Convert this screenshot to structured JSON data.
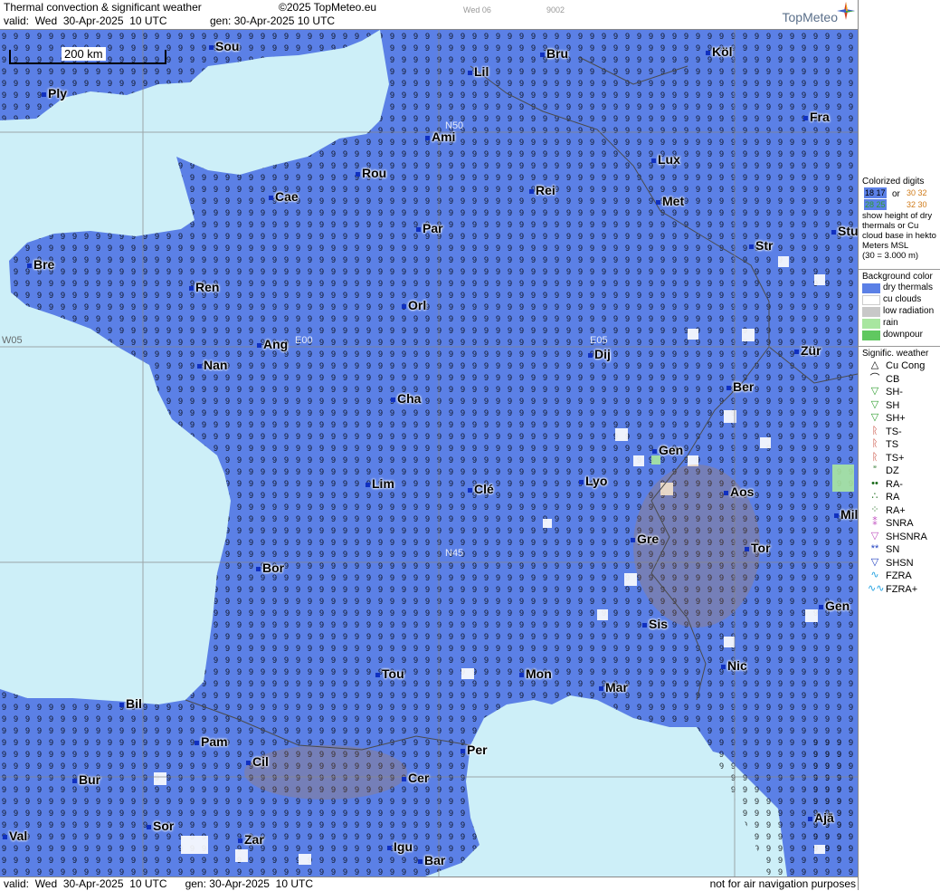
{
  "header": {
    "title": "Thermal convection & significant weather",
    "copyright": "©2025 TopMeteo.eu",
    "valid_label": "valid:",
    "valid_value": "Wed  30-Apr-2025  10 UTC",
    "gen_label": "gen:",
    "gen_value": "30-Apr-2025  10 UTC",
    "small_a": "Wed 06",
    "small_b": "9002",
    "brand": "TopMeteo"
  },
  "footer": {
    "valid_label": "valid:",
    "valid_value": "Wed  30-Apr-2025  10 UTC",
    "gen_label": "gen:",
    "gen_value": "30-Apr-2025  10 UTC",
    "disclaimer": "not for air navigation purposes"
  },
  "map": {
    "scale_label": "200 km",
    "coord_labels": [
      "N50",
      "N45",
      "W05",
      "E00",
      "E05"
    ],
    "colors": {
      "sea": "#cdeff8",
      "dry_thermals": "#5b80e6",
      "cu_clouds": "#ffffff",
      "low_radiation": "#c8c8c8",
      "rain": "#a8e6a0",
      "downpour": "#60c860",
      "digit_green": "#2f9e2f",
      "digit_orange": "#d07b19",
      "digit_red": "#c03020",
      "border": "#4a4a4a"
    },
    "cities": [
      "Sou",
      "Ply",
      "Lil",
      "Bru",
      "Köl",
      "Ami",
      "Fra",
      "Rou",
      "Lux",
      "Cae",
      "Rei",
      "Met",
      "Par",
      "Stu",
      "Bre",
      "Str",
      "Ren",
      "Orl",
      "Ang",
      "Zür",
      "Nan",
      "Dij",
      "Ber",
      "Cha",
      "Gen",
      "Lim",
      "Clé",
      "Lyo",
      "Aos",
      "Mil",
      "Gre",
      "Tor",
      "Bor",
      "Gen",
      "Sis",
      "Nic",
      "Tou",
      "Mon",
      "Mar",
      "Bil",
      "Pam",
      "Per",
      "Cil",
      "Bur",
      "Cer",
      "Sor",
      "Ajā",
      "Val",
      "Zar",
      "Igu",
      "Bar"
    ]
  },
  "legend": {
    "colorized_title": "Colorized digits",
    "colorized_or": "or",
    "colorized_ex1": "18 17",
    "colorized_ex2": "30 32",
    "colorized_ex3": "28 25",
    "colorized_ex4": "32 30",
    "colorized_text": "show height of dry thermals or Cu cloud base in hekto Meters MSL",
    "colorized_example": "(30 = 3.000 m)",
    "background_title": "Background color",
    "background_items": [
      {
        "label": "dry thermals",
        "color": "#5b80e6"
      },
      {
        "label": "cu clouds",
        "color": "#ffffff"
      },
      {
        "label": "low radiation",
        "color": "#c8c8c8"
      },
      {
        "label": "rain",
        "color": "#a8e6a0"
      },
      {
        "label": "downpour",
        "color": "#60c860"
      }
    ],
    "weather_title": "Signific. weather",
    "weather_items": [
      {
        "label": "Cu Cong",
        "symbol": "△",
        "color": "#000000"
      },
      {
        "label": "CB",
        "symbol": "⌒",
        "color": "#000000"
      },
      {
        "label": "SH-",
        "symbol": "▽",
        "color": "#2f9e2f"
      },
      {
        "label": "SH",
        "symbol": "▽",
        "color": "#2f9e2f"
      },
      {
        "label": "SH+",
        "symbol": "▽",
        "color": "#2f9e2f"
      },
      {
        "label": "TS-",
        "symbol": "ᚱ",
        "color": "#c03020"
      },
      {
        "label": "TS",
        "symbol": "ᚱ",
        "color": "#c03020"
      },
      {
        "label": "TS+",
        "symbol": "ᚱ",
        "color": "#c03020"
      },
      {
        "label": "DZ",
        "symbol": "”",
        "color": "#1a6a1a"
      },
      {
        "label": "RA-",
        "symbol": "••",
        "color": "#1a6a1a"
      },
      {
        "label": "RA",
        "symbol": "∴",
        "color": "#1a6a1a"
      },
      {
        "label": "RA+",
        "symbol": "⁘",
        "color": "#1a6a1a"
      },
      {
        "label": "SNRA",
        "symbol": "⁑",
        "color": "#c050c0"
      },
      {
        "label": "SHSNRA",
        "symbol": "▽",
        "color": "#c050c0"
      },
      {
        "label": "SN",
        "symbol": "**",
        "color": "#2040c0"
      },
      {
        "label": "SHSN",
        "symbol": "▽",
        "color": "#2040c0"
      },
      {
        "label": "FZRA",
        "symbol": "∿",
        "color": "#20a0e0"
      },
      {
        "label": "FZRA+",
        "symbol": "∿∿",
        "color": "#20a0e0"
      }
    ]
  }
}
